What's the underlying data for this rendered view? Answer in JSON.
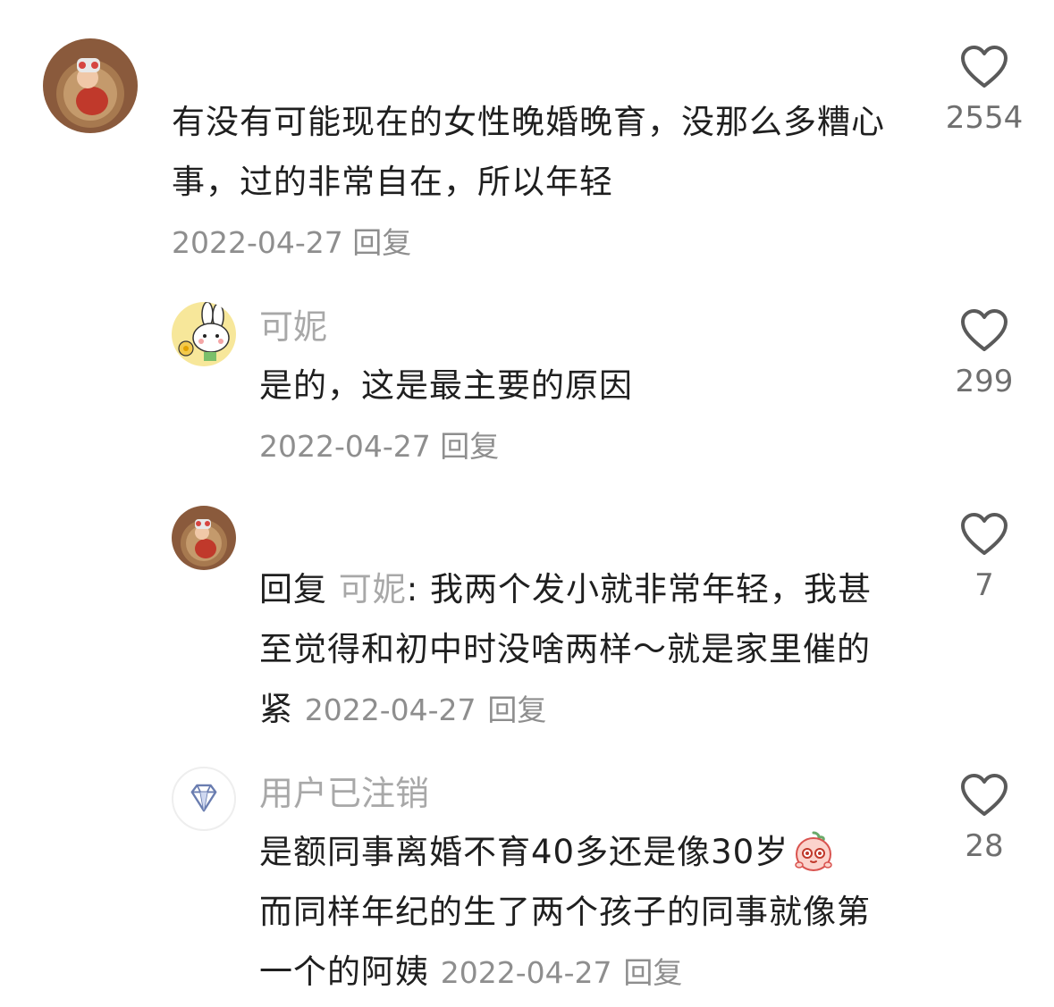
{
  "comments": [
    {
      "username": "",
      "text": "有没有可能现在的女性晚婚晚育，没那么多糟心事，过的非常自在，所以年轻",
      "date": "2022-04-27",
      "reply_label": "回复",
      "likes": "2554",
      "avatar": "baby-photo-avatar"
    },
    {
      "username": "可妮",
      "text": "是的，这是最主要的原因",
      "date": "2022-04-27",
      "reply_label": "回复",
      "likes": "299",
      "avatar": "bunny-avatar"
    },
    {
      "username": "",
      "reply_prefix": "回复",
      "reply_to": "可妮",
      "reply_colon": ":",
      "text": "我两个发小就非常年轻，我甚至觉得和初中时没啥两样～就是家里催的紧",
      "date": "2022-04-27",
      "reply_label": "回复",
      "likes": "7",
      "avatar": "baby-photo-avatar"
    },
    {
      "username": "用户已注销",
      "text": "是额同事离婚不育40多还是像30岁",
      "text_2": "而同样年纪的生了两个孩子的同事就像第一个的阿姨",
      "date": "2022-04-27",
      "reply_label": "回复",
      "likes": "28",
      "avatar": "diamond-avatar",
      "emoji": "blushing-emoji"
    }
  ],
  "icons": {
    "like": "heart-outline-icon"
  },
  "colors": {
    "text": "#1f1f1f",
    "muted": "#8e8e8e",
    "username": "#a8a8a8",
    "heart": "#5a5a5a"
  }
}
